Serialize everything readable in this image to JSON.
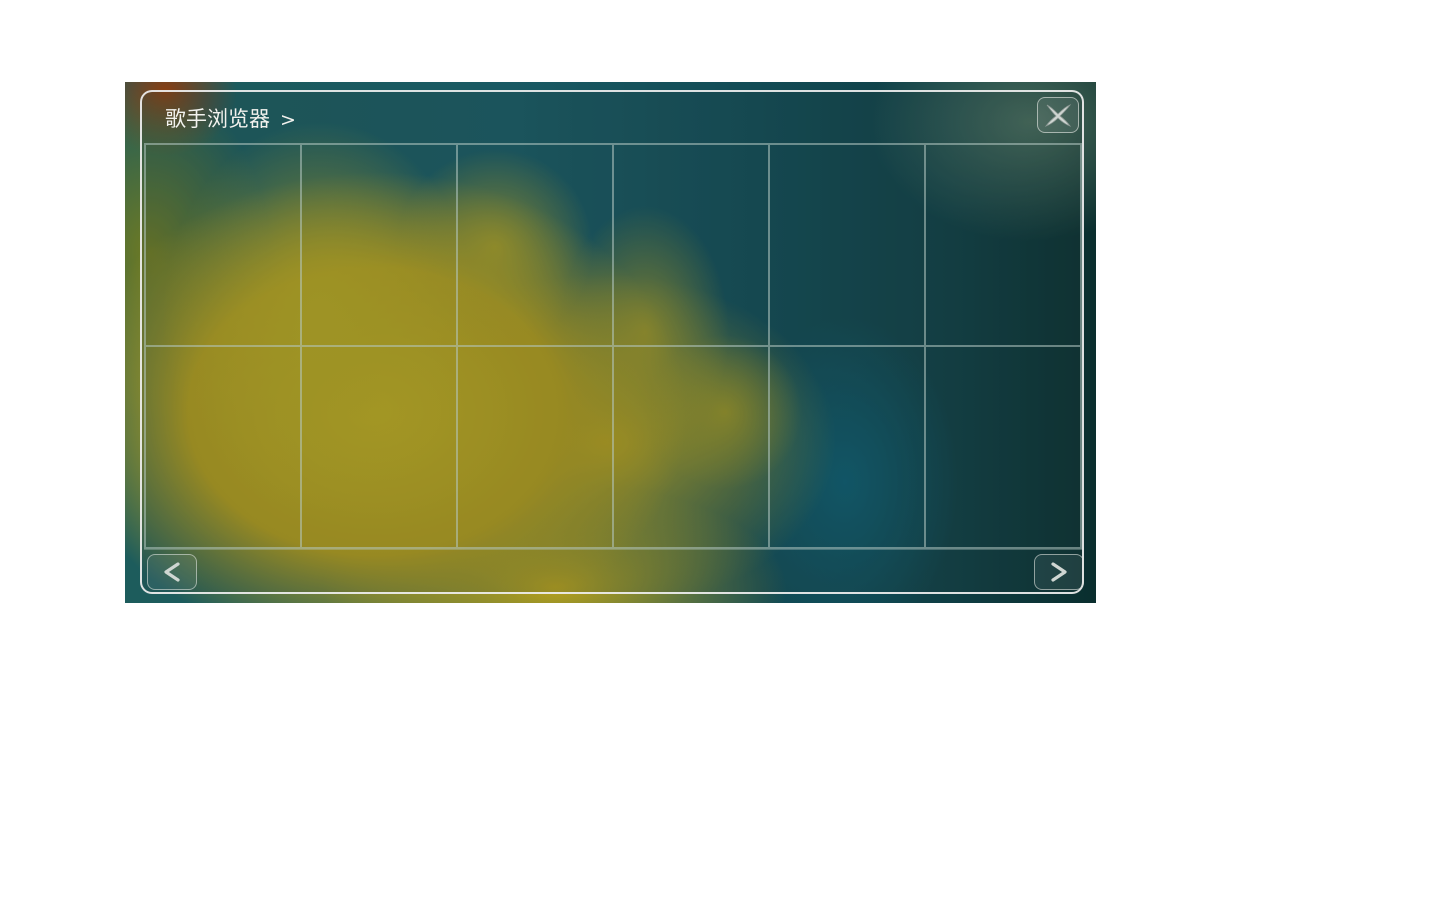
{
  "header": {
    "title": "歌手浏览器",
    "separator": ">"
  },
  "icons": {
    "close": "close-icon",
    "prev": "chevron-left-icon",
    "next": "chevron-right-icon"
  },
  "grid": {
    "columns": 6,
    "rows": 2
  },
  "colors": {
    "panel_border": "#f0f0f0",
    "title_text": "#f2f2ee",
    "grid_line": "#b4c8c3"
  }
}
